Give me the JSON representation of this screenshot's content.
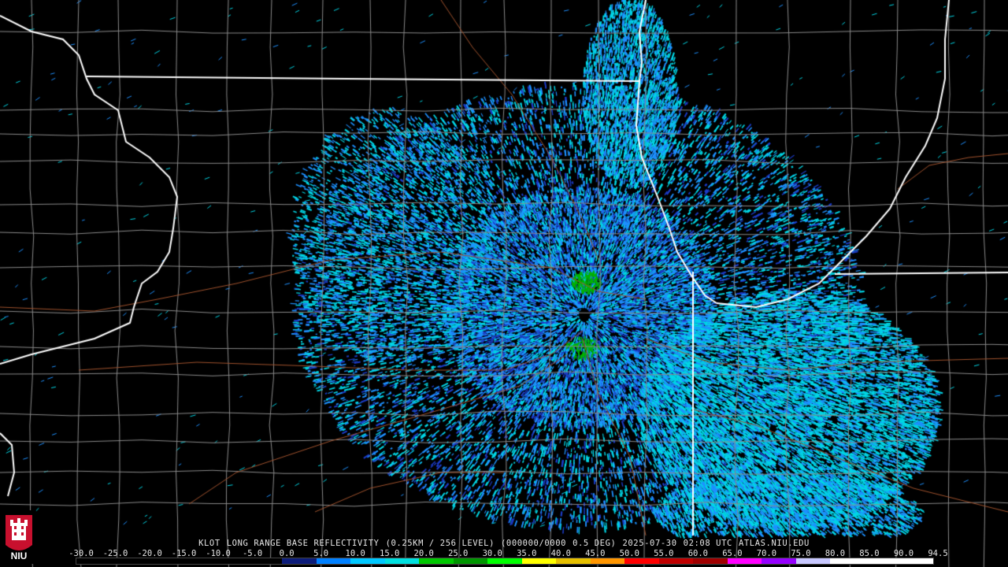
{
  "map": {
    "description_label": "KLOT radar reflectivity map of northern Illinois and Lake Michigan"
  },
  "header": {
    "station": "KLOT",
    "product": "LONG RANGE BASE REFLECTIVITY",
    "resolution": "(0.25KM / 256 LEVEL)",
    "volume": "(000000/0000",
    "elevation": "0.5 DEG)",
    "date": "2025-07-30",
    "time": "02:08 UTC",
    "site": "ATLAS.NIU.EDU"
  },
  "scale": {
    "labels": [
      "-30.0",
      "-25.0",
      "-20.0",
      "-15.0",
      "-10.0",
      "-5.0",
      "0.0",
      "5.0",
      "10.0",
      "15.0",
      "20.0",
      "25.0",
      "30.0",
      "35.0",
      "40.0",
      "45.0",
      "50.0",
      "55.0",
      "60.0",
      "65.0",
      "70.0",
      "75.0",
      "80.0",
      "85.0",
      "90.0",
      "94.5"
    ],
    "colors": [
      "#000000",
      "#000000",
      "#000000",
      "#000000",
      "#000000",
      "#000000",
      "#0c1c7a",
      "#0080ff",
      "#00c8ff",
      "#00e0e0",
      "#00c800",
      "#009600",
      "#00ff00",
      "#ffff00",
      "#e6c000",
      "#ff9600",
      "#ff0000",
      "#c00000",
      "#a00000",
      "#ff00ff",
      "#9600ff",
      "#c8c8ff",
      "#ffffff",
      "#ffffff",
      "#ffffff"
    ]
  },
  "logo": {
    "text": "NIU",
    "colors": {
      "red": "#c8102e",
      "white": "#ffffff"
    }
  },
  "map_colors": {
    "state_line": "#ffffff",
    "county_line": "#8a8a8a",
    "road": "#a0522d",
    "echo_light": "#00d7e6",
    "echo_mid": "#1e90ff",
    "echo_dark": "#1c3cc8",
    "echo_green": "#00b400"
  }
}
